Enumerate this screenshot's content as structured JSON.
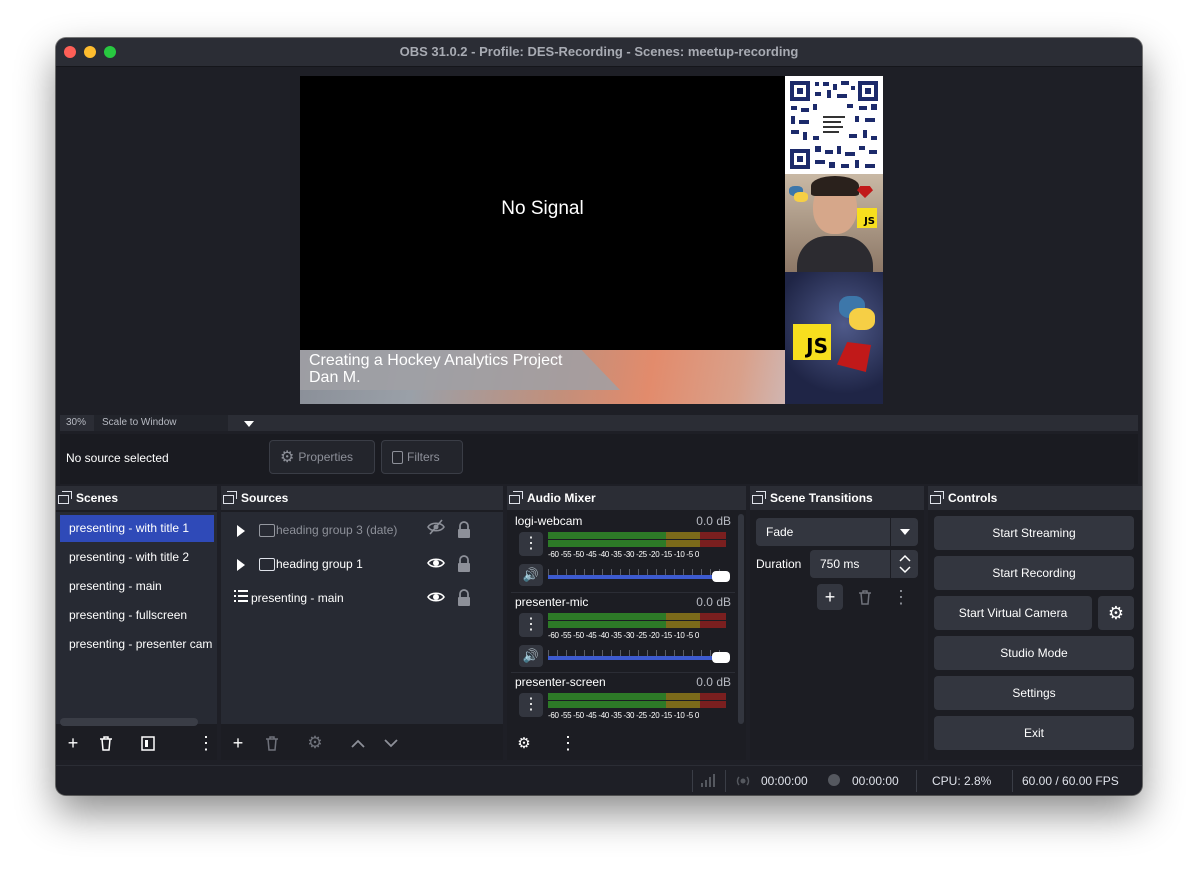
{
  "window": {
    "title": "OBS 31.0.2 - Profile: DES-Recording - Scenes: meetup-recording"
  },
  "preview": {
    "no_signal": "No Signal",
    "lower_third_line1": "Creating a Hockey Analytics Project",
    "lower_third_line2": "Dan M.",
    "badge_js_1": "JS",
    "badge_js_2": "JS"
  },
  "zoom": {
    "level": "30%",
    "scale_mode": "Scale to Window"
  },
  "context": {
    "no_source": "No source selected",
    "properties_label": "Properties",
    "filters_label": "Filters"
  },
  "scenes": {
    "title": "Scenes",
    "items": [
      {
        "label": "presenting - with title 1",
        "selected": true
      },
      {
        "label": "presenting - with title 2",
        "selected": false
      },
      {
        "label": "presenting - main",
        "selected": false
      },
      {
        "label": "presenting - fullscreen",
        "selected": false
      },
      {
        "label": "presenting - presenter cam",
        "selected": false
      }
    ]
  },
  "sources": {
    "title": "Sources",
    "items": [
      {
        "label": "heading group 3 (date)",
        "type": "group",
        "visible": false,
        "locked": true
      },
      {
        "label": "heading group 1",
        "type": "group",
        "visible": true,
        "locked": true
      },
      {
        "label": "presenting - main",
        "type": "scene",
        "visible": true,
        "locked": true
      }
    ]
  },
  "mixer": {
    "title": "Audio Mixer",
    "scale": "-60 -55 -50 -45 -40 -35 -30 -25 -20 -15 -10 -5  0",
    "channels": [
      {
        "name": "logi-webcam",
        "db": "0.0 dB",
        "volume": 1.0
      },
      {
        "name": "presenter-mic",
        "db": "0.0 dB",
        "volume": 1.0
      },
      {
        "name": "presenter-screen",
        "db": "0.0 dB",
        "volume": 1.0
      }
    ]
  },
  "transitions": {
    "title": "Scene Transitions",
    "selected": "Fade",
    "duration_label": "Duration",
    "duration_value": "750 ms"
  },
  "controls": {
    "title": "Controls",
    "start_streaming": "Start Streaming",
    "start_recording": "Start Recording",
    "start_virtual_camera": "Start Virtual Camera",
    "studio_mode": "Studio Mode",
    "settings": "Settings",
    "exit": "Exit"
  },
  "status": {
    "stream_time": "00:00:00",
    "record_time": "00:00:00",
    "cpu": "CPU: 2.8%",
    "fps": "60.00 / 60.00 FPS"
  },
  "colors": {
    "accent": "#2f4ab8",
    "window_bg": "#1e1f26",
    "panel_bg": "#272a33"
  }
}
